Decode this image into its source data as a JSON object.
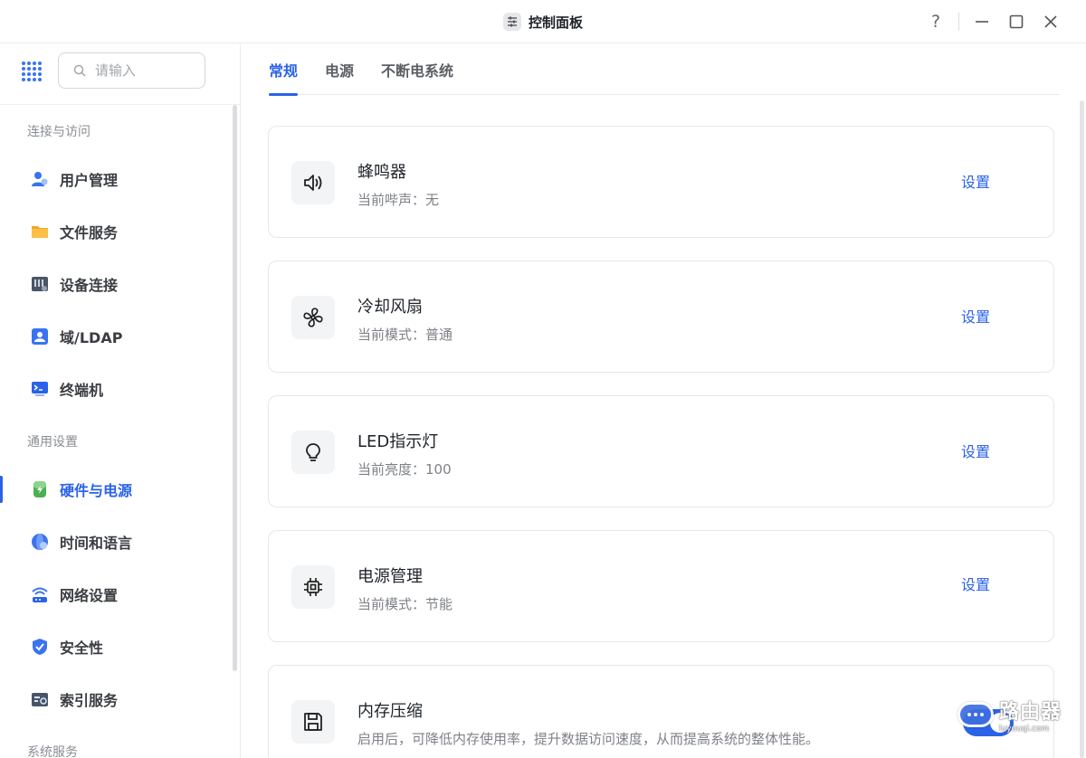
{
  "window": {
    "title": "控制面板",
    "help_label": "?"
  },
  "search": {
    "placeholder": "请输入"
  },
  "sidebar": {
    "sections": [
      {
        "title": "连接与访问",
        "items": [
          {
            "label": "用户管理",
            "icon": "user-management-icon"
          },
          {
            "label": "文件服务",
            "icon": "folder-icon"
          },
          {
            "label": "设备连接",
            "icon": "device-connection-icon"
          },
          {
            "label": "域/LDAP",
            "icon": "domain-ldap-icon"
          },
          {
            "label": "终端机",
            "icon": "terminal-icon"
          }
        ]
      },
      {
        "title": "通用设置",
        "items": [
          {
            "label": "硬件与电源",
            "icon": "hardware-power-icon",
            "active": true
          },
          {
            "label": "时间和语言",
            "icon": "globe-icon"
          },
          {
            "label": "网络设置",
            "icon": "network-icon"
          },
          {
            "label": "安全性",
            "icon": "shield-icon"
          },
          {
            "label": "索引服务",
            "icon": "index-service-icon"
          }
        ]
      },
      {
        "title": "系统服务",
        "items": []
      }
    ]
  },
  "tabs": [
    {
      "label": "常规",
      "active": true
    },
    {
      "label": "电源",
      "active": false
    },
    {
      "label": "不断电系统",
      "active": false
    }
  ],
  "cards": [
    {
      "title": "蜂鸣器",
      "desc": "当前哔声：无",
      "action": "设置",
      "icon": "speaker-icon"
    },
    {
      "title": "冷却风扇",
      "desc": "当前模式：普通",
      "action": "设置",
      "icon": "fan-icon"
    },
    {
      "title": "LED指示灯",
      "desc": "当前亮度：100",
      "action": "设置",
      "icon": "lightbulb-icon"
    },
    {
      "title": "电源管理",
      "desc": "当前模式：节能",
      "action": "设置",
      "icon": "chip-icon"
    },
    {
      "title": "内存压缩",
      "desc": "启用后，可降低内存使用率，提升数据访问速度，从而提高系统的整体性能。",
      "toggle": true,
      "icon": "floppy-disk-icon"
    }
  ],
  "watermark": {
    "main": "路由器",
    "sub": "luyouqi.com"
  },
  "colors": {
    "accent": "#2a62e8",
    "text": "#1f2329",
    "muted": "#7e8187"
  }
}
